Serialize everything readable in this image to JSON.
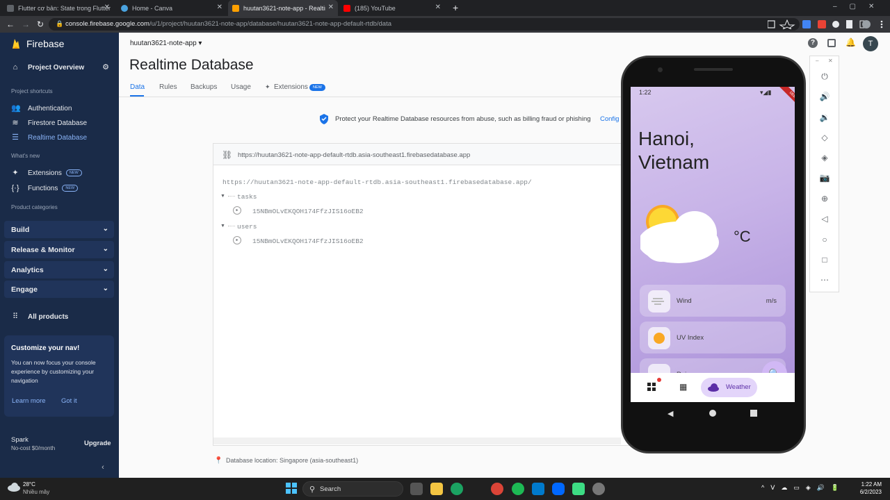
{
  "browser": {
    "tabs": [
      {
        "title": "Flutter cơ bản: State trong Flutter",
        "active": false
      },
      {
        "title": "Home - Canva",
        "active": false
      },
      {
        "title": "huutan3621-note-app - Realtime",
        "active": true
      },
      {
        "title": "(185) YouTube",
        "active": false
      }
    ],
    "url_domain": "console.firebase.google.com",
    "url_path": "/u/1/project/huutan3621-note-app/database/huutan3621-note-app-default-rtdb/data"
  },
  "sidebar": {
    "brand": "Firebase",
    "project_overview": "Project Overview",
    "shortcuts_heading": "Project shortcuts",
    "shortcuts": [
      "Authentication",
      "Firestore Database",
      "Realtime Database"
    ],
    "whats_new_heading": "What's new",
    "new_items": [
      "Extensions",
      "Functions"
    ],
    "new_badge": "NEW",
    "categories_heading": "Product categories",
    "sections": [
      "Build",
      "Release & Monitor",
      "Analytics",
      "Engage"
    ],
    "all_products": "All products",
    "customize": {
      "title": "Customize your nav!",
      "body": "You can now focus your console experience by customizing your navigation",
      "learn_more": "Learn more",
      "got_it": "Got it"
    },
    "plan_name": "Spark",
    "plan_desc": "No-cost $0/month",
    "upgrade": "Upgrade"
  },
  "header": {
    "project_select": "huutan3621-note-app",
    "page_title": "Realtime Database",
    "user_initial": "T"
  },
  "db_tabs": [
    "Data",
    "Rules",
    "Backups",
    "Usage",
    "Extensions"
  ],
  "banner": {
    "text": "Protect your Realtime Database resources from abuse, such as billing fraud or phishing",
    "link": "Config"
  },
  "db": {
    "ref_url": "https://huutan3621-note-app-default-rtdb.asia-southeast1.firebasedatabase.app",
    "root_url": "https://huutan3621-note-app-default-rtdb.asia-southeast1.firebasedatabase.app/",
    "nodes": [
      {
        "key": "tasks",
        "child": "15NBmOLvEKQOH174FfzJIS16oEB2"
      },
      {
        "key": "users",
        "child": "15NBmOLvEKQOH174FfzJIS16oEB2"
      }
    ],
    "location": "Database location: Singapore (asia-southeast1)"
  },
  "phone": {
    "time": "1:22",
    "debug": "DEBUG",
    "city_line1": "Hanoi,",
    "city_line2": "Vietnam",
    "unit": "°C",
    "cards": [
      {
        "label": "Wind",
        "value": "m/s"
      },
      {
        "label": "UV Index",
        "value": ""
      },
      {
        "label": "Rain",
        "value": ""
      }
    ],
    "nav_active": "Weather"
  },
  "taskbar": {
    "temp": "28°C",
    "weather": "Nhiều mây",
    "search": "Search",
    "clock_time": "1:22 AM",
    "clock_date": "6/2/2023"
  },
  "colors": {
    "firebase_nav": "#1a2b48",
    "accent": "#1a73e8",
    "phone_purple": "#c8b4e8",
    "weather_pill": "#e3d5fa"
  }
}
